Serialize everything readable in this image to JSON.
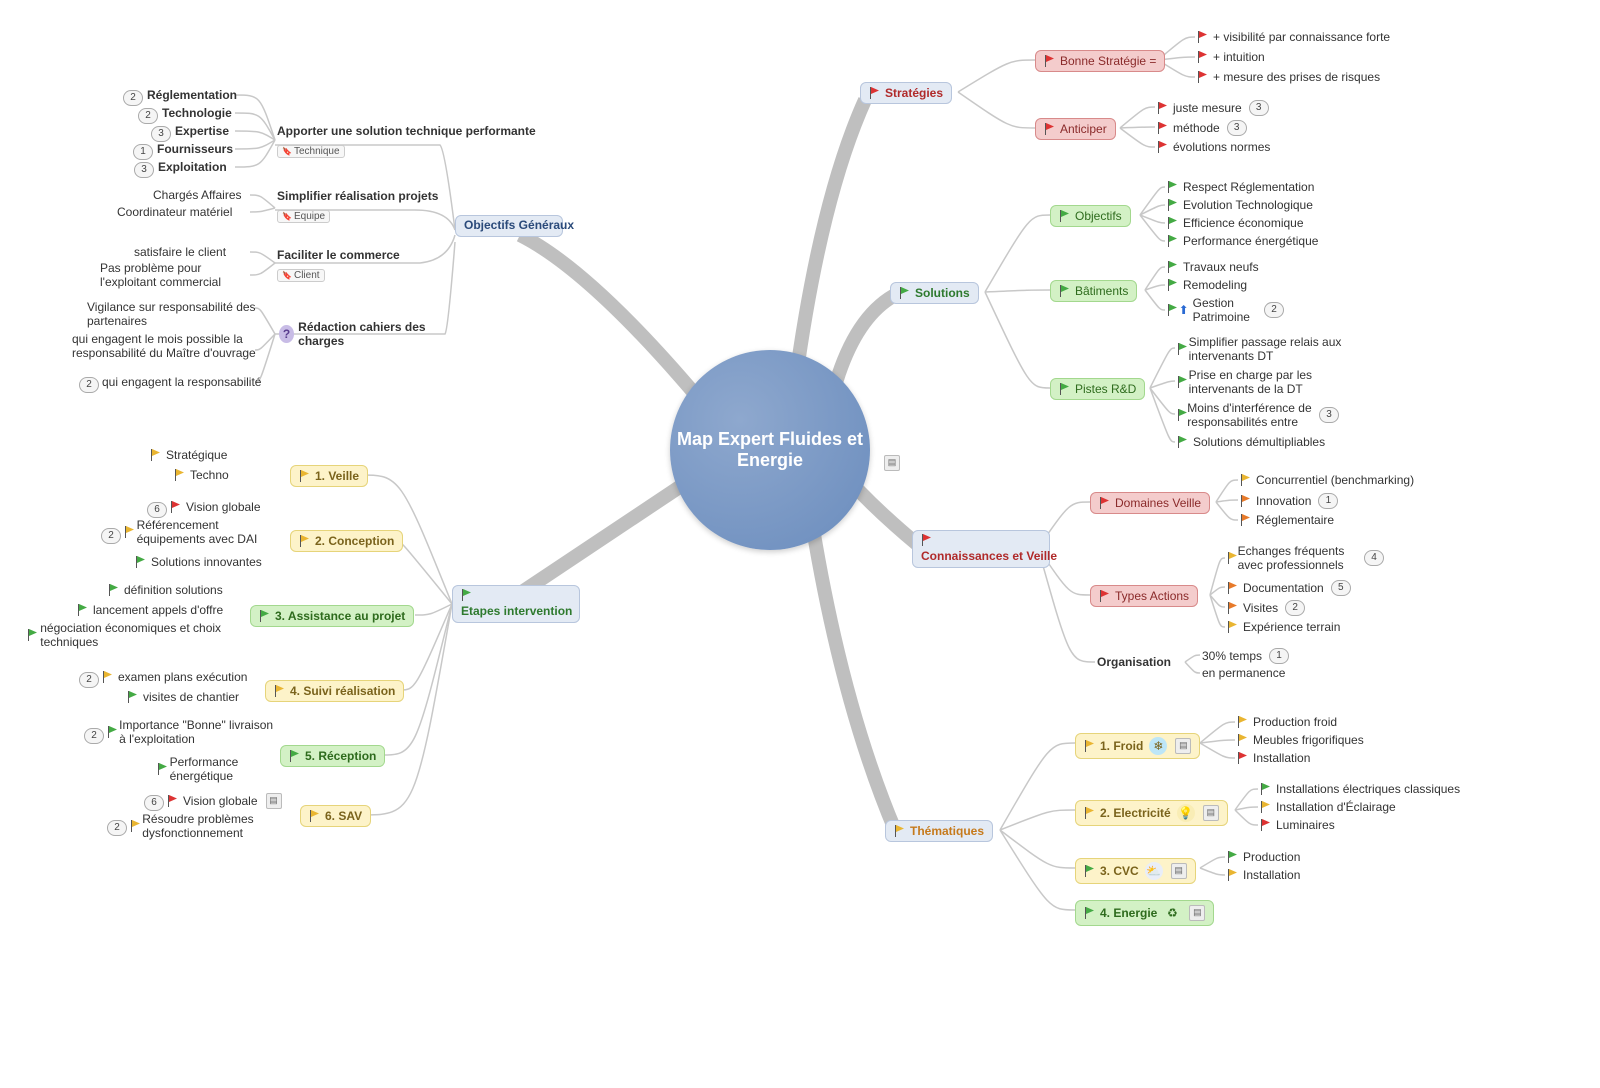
{
  "central": "Map Expert Fluides et Energie",
  "hub_objectifs": "Objectifs Généraux",
  "hub_etapes": "Etapes intervention",
  "hub_strategies": "Stratégies",
  "hub_solutions": "Solutions",
  "hub_connaissances": "Connaissances et Veille",
  "hub_thematiques": "Thématiques",
  "objectifs": {
    "n1": "Apporter une solution technique performante",
    "n1_tag": "Technique",
    "n1_children": {
      "a": "Réglementation",
      "a_num": "2",
      "b": "Technologie",
      "b_num": "2",
      "c": "Expertise",
      "c_num": "3",
      "d": "Fournisseurs",
      "d_num": "1",
      "e": "Exploitation",
      "e_num": "3"
    },
    "n2": "Simplifier réalisation projets",
    "n2_tag": "Equipe",
    "n2_children": {
      "a": "Chargés Affaires",
      "b": "Coordinateur matériel"
    },
    "n3": "Faciliter le commerce",
    "n3_tag": "Client",
    "n3_children": {
      "a": "satisfaire le client",
      "b": "Pas problème pour l'exploitant commercial"
    },
    "n4": "Rédaction cahiers des charges",
    "n4_icon": "?",
    "n4_children": {
      "a": "Vigilance sur responsabilité des partenaires",
      "b": "qui engagent le mois possible la responsabilité du Maître d'ouvrage",
      "c": "qui engagent la responsabilité",
      "c_num": "2"
    }
  },
  "etapes": {
    "e1": "1. Veille",
    "e1_children": {
      "a": "Stratégique",
      "b": "Techno"
    },
    "e2": "2. Conception",
    "e2_children": {
      "a": "Vision globale",
      "a_num": "6",
      "b": "Référencement équipements avec DAI",
      "b_num": "2",
      "c": "Solutions innovantes"
    },
    "e3": "3. Assistance au projet",
    "e3_children": {
      "a": "définition solutions",
      "b": "lancement appels d'offre",
      "c": "négociation économiques et choix techniques"
    },
    "e4": "4. Suivi réalisation",
    "e4_children": {
      "a": "examen plans exécution",
      "a_num": "2",
      "b": "visites de chantier"
    },
    "e5": "5. Réception",
    "e5_children": {
      "a": "Importance \"Bonne\" livraison à l'exploitation",
      "a_num": "2",
      "b": "Performance énergétique"
    },
    "e6": "6. SAV",
    "e6_children": {
      "a": "Vision globale",
      "a_num": "6",
      "b": "Résoudre problèmes dysfonctionnement",
      "b_num": "2"
    }
  },
  "strategies": {
    "s1": "Bonne Stratégie =",
    "s1_children": {
      "a": "+ visibilité par connaissance forte",
      "b": "+ intuition",
      "c": "+ mesure des prises de risques"
    },
    "s2": "Anticiper",
    "s2_children": {
      "a": "juste mesure",
      "a_num": "3",
      "b": "méthode",
      "b_num": "3",
      "c": "évolutions normes"
    }
  },
  "solutions": {
    "o1": "Objectifs",
    "o1_children": {
      "a": "Respect Réglementation",
      "b": "Evolution Technologique",
      "c": "Efficience économique",
      "d": "Performance énergétique"
    },
    "o2": "Bâtiments",
    "o2_children": {
      "a": "Travaux neufs",
      "b": "Remodeling",
      "c": "Gestion Patrimoine",
      "c_num": "2"
    },
    "o3": "Pistes R&D",
    "o3_children": {
      "a": "Simplifier passage relais aux intervenants DT",
      "b": "Prise en charge par les intervenants de la DT",
      "c": "Moins d'interférence de responsabilités entre",
      "c_num": "3",
      "d": "Solutions démultipliables"
    }
  },
  "veille": {
    "v1": "Domaines Veille",
    "v1_children": {
      "a": "Concurrentiel (benchmarking)",
      "b": "Innovation",
      "b_num": "1",
      "c": "Réglementaire"
    },
    "v2": "Types Actions",
    "v2_children": {
      "a": "Echanges fréquents avec professionnels",
      "a_num": "4",
      "b": "Documentation",
      "b_num": "5",
      "c": "Visites",
      "c_num": "2",
      "d": "Expérience terrain"
    },
    "v3": "Organisation",
    "v3_children": {
      "a": "30% temps",
      "a_num": "1",
      "b": "en permanence"
    }
  },
  "them": {
    "t1": "1. Froid",
    "t1_children": {
      "a": "Production froid",
      "b": "Meubles frigorifiques",
      "c": "Installation"
    },
    "t2": "2. Electricité",
    "t2_children": {
      "a": "Installations électriques classiques",
      "b": "Installation d'Éclairage",
      "c": "Luminaires"
    },
    "t3": "3. CVC",
    "t3_children": {
      "a": "Production",
      "b": "Installation"
    },
    "t4": "4. Energie"
  }
}
